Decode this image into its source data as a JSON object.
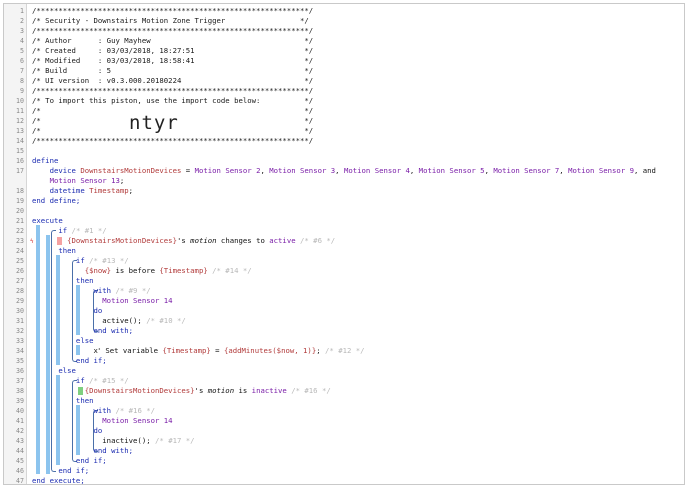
{
  "lines": [
    {
      "n": "1",
      "parts": [
        {
          "t": "/**************************************************************/",
          "c": "t-comment"
        }
      ]
    },
    {
      "n": "2",
      "parts": [
        {
          "t": "/* Security - Downstairs Motion Zone Trigger                 */",
          "c": "t-comment"
        }
      ]
    },
    {
      "n": "3",
      "parts": [
        {
          "t": "/**************************************************************/",
          "c": "t-comment"
        }
      ]
    },
    {
      "n": "4",
      "parts": [
        {
          "t": "/* Author      : Guy Mayhew                                   */",
          "c": "t-comment"
        }
      ]
    },
    {
      "n": "5",
      "parts": [
        {
          "t": "/* Created     : 03/03/2018, 18:27:51                         */",
          "c": "t-comment"
        }
      ]
    },
    {
      "n": "6",
      "parts": [
        {
          "t": "/* Modified    : 03/03/2018, 18:58:41                         */",
          "c": "t-comment"
        }
      ]
    },
    {
      "n": "7",
      "parts": [
        {
          "t": "/* Build       : 5                                            */",
          "c": "t-comment"
        }
      ]
    },
    {
      "n": "8",
      "parts": [
        {
          "t": "/* UI version  : v0.3.000.20180224                            */",
          "c": "t-comment"
        }
      ]
    },
    {
      "n": "9",
      "parts": [
        {
          "t": "/**************************************************************/",
          "c": "t-comment"
        }
      ]
    },
    {
      "n": "10",
      "parts": [
        {
          "t": "/* To import this piston, use the import code below:          */",
          "c": "t-comment"
        }
      ]
    },
    {
      "n": "11",
      "parts": [
        {
          "t": "/*                                                            */",
          "c": "t-comment"
        }
      ]
    },
    {
      "n": "12",
      "parts": [
        {
          "t": "/*                                                            */",
          "c": "t-comment"
        }
      ]
    },
    {
      "n": "13",
      "parts": [
        {
          "t": "/*                                                            */",
          "c": "t-comment"
        }
      ]
    },
    {
      "n": "14",
      "parts": [
        {
          "t": "/**************************************************************/",
          "c": "t-comment"
        }
      ]
    },
    {
      "n": "15",
      "parts": []
    },
    {
      "n": "16",
      "parts": [
        {
          "t": "define",
          "c": "t-kw"
        }
      ]
    },
    {
      "n": "17",
      "parts": [
        {
          "t": "    device ",
          "c": "t-kw"
        },
        {
          "t": "DownstairsMotionDevices",
          "c": "t-dev"
        },
        {
          "t": " = ",
          "c": "t-text"
        },
        {
          "t": "Motion Sensor 2",
          "c": "t-purple"
        },
        {
          "t": ", ",
          "c": "t-text"
        },
        {
          "t": "Motion Sensor 3",
          "c": "t-purple"
        },
        {
          "t": ", ",
          "c": "t-text"
        },
        {
          "t": "Motion Sensor 4",
          "c": "t-purple"
        },
        {
          "t": ", ",
          "c": "t-text"
        },
        {
          "t": "Motion Sensor 5",
          "c": "t-purple"
        },
        {
          "t": ", ",
          "c": "t-text"
        },
        {
          "t": "Motion Sensor 7",
          "c": "t-purple"
        },
        {
          "t": ", ",
          "c": "t-text"
        },
        {
          "t": "Motion Sensor 9",
          "c": "t-purple"
        },
        {
          "t": ", and",
          "c": "t-text"
        }
      ]
    },
    {
      "n": "",
      "parts": [
        {
          "t": "    Motion Sensor 13",
          "c": "t-purple"
        },
        {
          "t": ";",
          "c": "t-text"
        }
      ]
    },
    {
      "n": "18",
      "parts": [
        {
          "t": "    datetime ",
          "c": "t-kw"
        },
        {
          "t": "Timestamp",
          "c": "t-dev"
        },
        {
          "t": ";",
          "c": "t-text"
        }
      ]
    },
    {
      "n": "19",
      "parts": [
        {
          "t": "end define;",
          "c": "t-kw"
        }
      ]
    },
    {
      "n": "20",
      "parts": []
    },
    {
      "n": "21",
      "parts": [
        {
          "t": "execute",
          "c": "t-kw"
        }
      ]
    },
    {
      "n": "22",
      "parts": [
        {
          "t": "      if ",
          "c": "t-kw"
        },
        {
          "t": "/* #1 */",
          "c": "t-faint"
        }
      ]
    },
    {
      "n": "23",
      "parts": [
        {
          "t": "        {DownstairsMotionDevices}",
          "c": "t-dev"
        },
        {
          "t": "'s ",
          "c": "t-text"
        },
        {
          "t": "motion",
          "c": "t-text t-italic"
        },
        {
          "t": " changes to ",
          "c": "t-text"
        },
        {
          "t": "active",
          "c": "t-purple"
        },
        {
          "t": " /* #6 */",
          "c": "t-faint"
        }
      ]
    },
    {
      "n": "24",
      "parts": [
        {
          "t": "      then",
          "c": "t-kw"
        }
      ]
    },
    {
      "n": "25",
      "parts": [
        {
          "t": "          if ",
          "c": "t-kw"
        },
        {
          "t": "/* #13 */",
          "c": "t-faint"
        }
      ]
    },
    {
      "n": "26",
      "parts": [
        {
          "t": "            {$now}",
          "c": "t-dev"
        },
        {
          "t": " is before ",
          "c": "t-text"
        },
        {
          "t": "{Timestamp}",
          "c": "t-dev"
        },
        {
          "t": " /* #14 */",
          "c": "t-faint"
        }
      ]
    },
    {
      "n": "27",
      "parts": [
        {
          "t": "          then",
          "c": "t-kw"
        }
      ]
    },
    {
      "n": "28",
      "parts": [
        {
          "t": "              with ",
          "c": "t-kw"
        },
        {
          "t": "/* #9 */",
          "c": "t-faint"
        }
      ]
    },
    {
      "n": "29",
      "parts": [
        {
          "t": "                Motion Sensor 14",
          "c": "t-purple"
        }
      ]
    },
    {
      "n": "30",
      "parts": [
        {
          "t": "              do",
          "c": "t-kw"
        }
      ]
    },
    {
      "n": "31",
      "parts": [
        {
          "t": "                active(); ",
          "c": "t-text"
        },
        {
          "t": "/* #10 */",
          "c": "t-faint"
        }
      ]
    },
    {
      "n": "32",
      "parts": [
        {
          "t": "              end with;",
          "c": "t-kw"
        }
      ]
    },
    {
      "n": "33",
      "parts": [
        {
          "t": "          else",
          "c": "t-kw"
        }
      ]
    },
    {
      "n": "34",
      "parts": [
        {
          "t": "              x",
          "c": "t-text"
        },
        {
          "t": "²",
          "c": "t-text t-sup"
        },
        {
          "t": " Set variable ",
          "c": "t-text"
        },
        {
          "t": "{Timestamp}",
          "c": "t-dev"
        },
        {
          "t": " = ",
          "c": "t-text"
        },
        {
          "t": "{addMinutes($now, 1)}",
          "c": "t-dev"
        },
        {
          "t": "; ",
          "c": "t-text"
        },
        {
          "t": "/* #12 */",
          "c": "t-faint"
        }
      ]
    },
    {
      "n": "35",
      "parts": [
        {
          "t": "          end if;",
          "c": "t-kw"
        }
      ]
    },
    {
      "n": "36",
      "parts": [
        {
          "t": "      else",
          "c": "t-kw"
        }
      ]
    },
    {
      "n": "37",
      "parts": [
        {
          "t": "          if ",
          "c": "t-kw"
        },
        {
          "t": "/* #15 */",
          "c": "t-faint"
        }
      ]
    },
    {
      "n": "38",
      "parts": [
        {
          "t": "            {DownstairsMotionDevices}",
          "c": "t-dev"
        },
        {
          "t": "'s ",
          "c": "t-text"
        },
        {
          "t": "motion",
          "c": "t-text t-italic"
        },
        {
          "t": " is ",
          "c": "t-text"
        },
        {
          "t": "inactive",
          "c": "t-purple"
        },
        {
          "t": " /* #16 */",
          "c": "t-faint"
        }
      ]
    },
    {
      "n": "39",
      "parts": [
        {
          "t": "          then",
          "c": "t-kw"
        }
      ]
    },
    {
      "n": "40",
      "parts": [
        {
          "t": "              with ",
          "c": "t-kw"
        },
        {
          "t": "/* #16 */",
          "c": "t-faint"
        }
      ]
    },
    {
      "n": "41",
      "parts": [
        {
          "t": "                Motion Sensor 14",
          "c": "t-purple"
        }
      ]
    },
    {
      "n": "42",
      "parts": [
        {
          "t": "              do",
          "c": "t-kw"
        }
      ]
    },
    {
      "n": "43",
      "parts": [
        {
          "t": "                inactive(); ",
          "c": "t-text"
        },
        {
          "t": "/* #17 */",
          "c": "t-faint"
        }
      ]
    },
    {
      "n": "44",
      "parts": [
        {
          "t": "              end with;",
          "c": "t-kw"
        }
      ]
    },
    {
      "n": "45",
      "parts": [
        {
          "t": "          end if;",
          "c": "t-kw"
        }
      ]
    },
    {
      "n": "46",
      "parts": [
        {
          "t": "      end if;",
          "c": "t-kw"
        }
      ]
    },
    {
      "n": "47",
      "parts": [
        {
          "t": "end execute;",
          "c": "t-kw"
        }
      ]
    }
  ],
  "import_code": "ntyr",
  "trigger_marker": "ϟ",
  "colors": {
    "keyword": "#1a2ab0",
    "device": "#b13a3a",
    "value": "#7a1ea8",
    "comment_faint": "#b8b8b8",
    "nesting_bar": "#8cc4ee"
  }
}
